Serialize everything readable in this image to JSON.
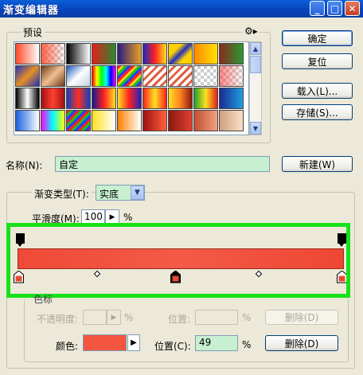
{
  "window": {
    "title": "渐变编辑器",
    "min_label": "_",
    "max_label": "□",
    "close_label": "✕"
  },
  "presets": {
    "legend": "预设",
    "menu_icon": "gear-icon"
  },
  "buttons": {
    "ok": "确定",
    "reset": "复位",
    "load": "载入(L)...",
    "save": "存储(S)...",
    "new": "新建(W)",
    "delete_opacity": "删除(D)",
    "delete_color": "删除(D)"
  },
  "name": {
    "label": "名称(N):",
    "value": "自定"
  },
  "gradient_type": {
    "label": "渐变类型(T):",
    "value": "实底"
  },
  "smoothness": {
    "label": "平滑度(M):",
    "value": "100",
    "unit": "%"
  },
  "stops": {
    "legend": "色标",
    "opacity_label": "不透明度:",
    "opacity_unit": "%",
    "opacity_location_label": "位置:",
    "opacity_location_unit": "%",
    "color_label": "颜色:",
    "color_value": "#f4553f",
    "location_label": "位置(C):",
    "location_value": "49",
    "location_unit": "%"
  },
  "colors": {
    "highlight": "#17e11a",
    "gradient_start": "#ef4a37",
    "gradient_end": "#ef4634",
    "stop_fill": "#e64a32"
  }
}
